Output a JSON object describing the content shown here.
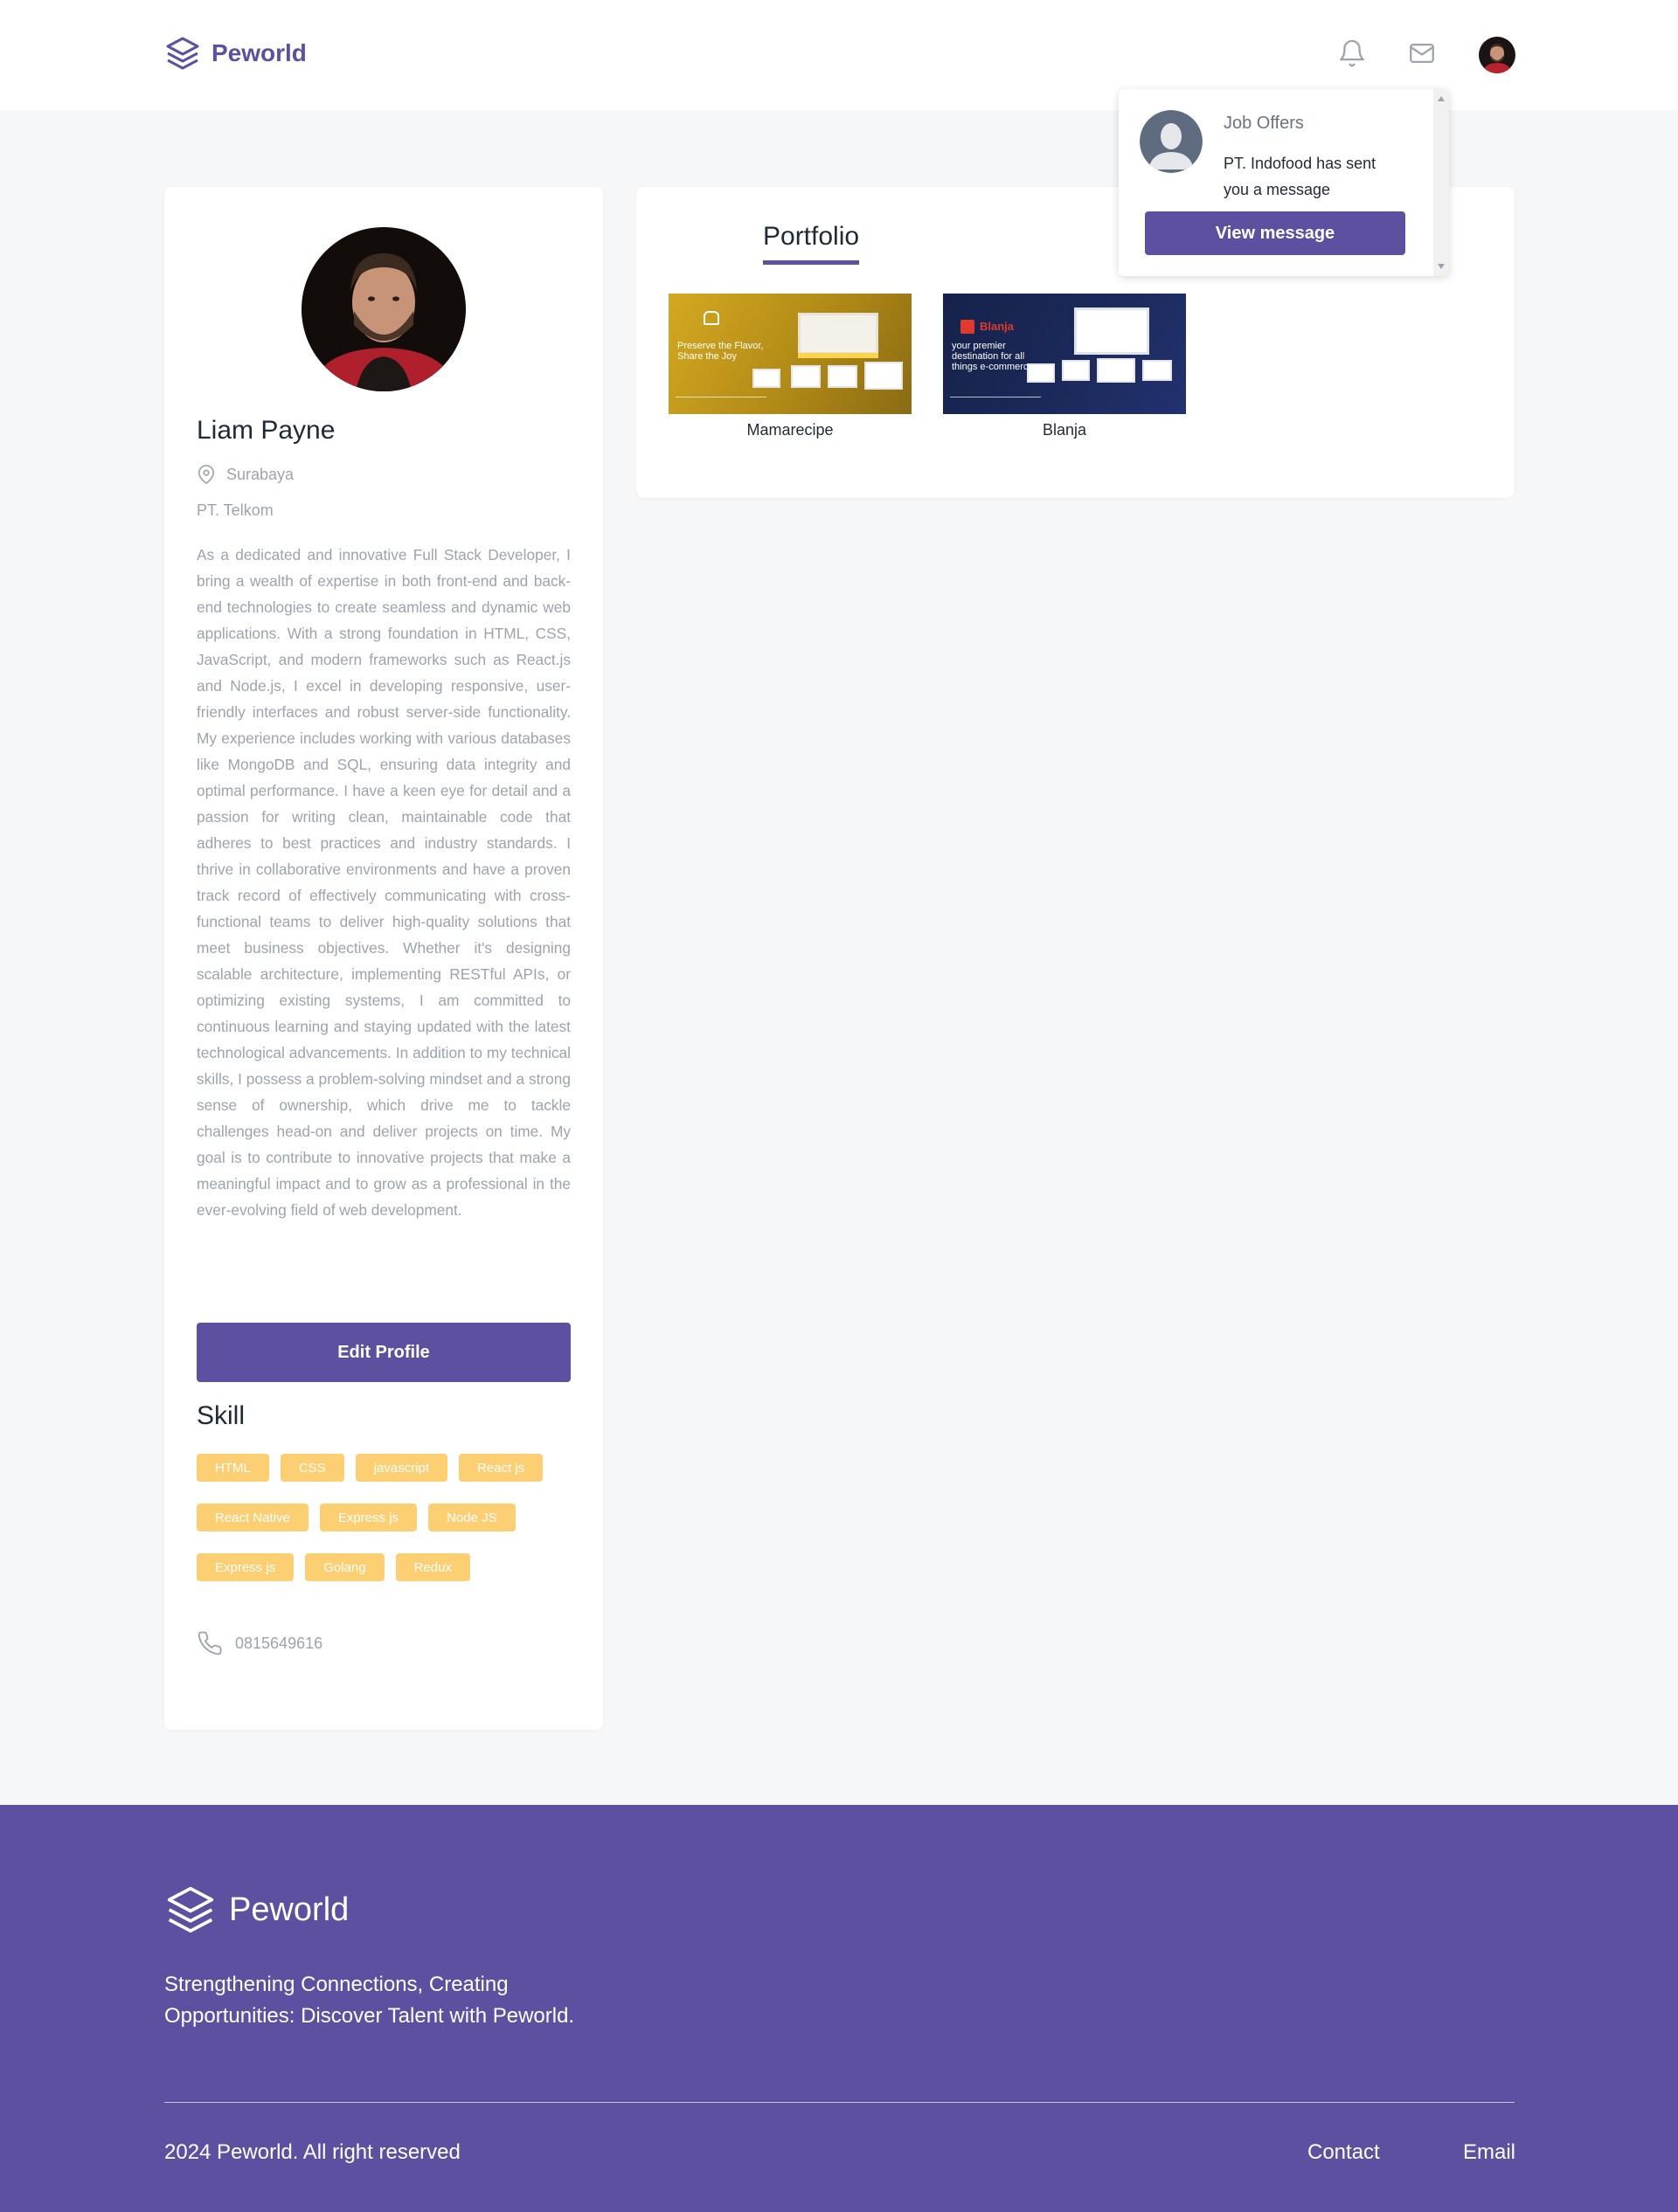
{
  "navbar": {
    "brand": "Peworld",
    "icons": [
      "bell-icon",
      "mail-icon"
    ]
  },
  "notification": {
    "title": "Job Offers",
    "message": "PT. Indofood has sent you a message",
    "button_label": "View message"
  },
  "profile": {
    "name": "Liam Payne",
    "location": "Surabaya",
    "company": "PT. Telkom",
    "bio": "As a dedicated and innovative Full Stack Developer, I bring a wealth of expertise in both front-end and back-end technologies to create seamless and dynamic web applications. With a strong foundation in HTML, CSS, JavaScript, and modern frameworks such as React.js and Node.js, I excel in developing responsive, user-friendly interfaces and robust server-side functionality. My experience includes working with various databases like MongoDB and SQL, ensuring data integrity and optimal performance. I have a keen eye for detail and a passion for writing clean, maintainable code that adheres to best practices and industry standards. I thrive in collaborative environments and have a proven track record of effectively communicating with cross-functional teams to deliver high-quality solutions that meet business objectives. Whether it's designing scalable architecture, implementing RESTful APIs, or optimizing existing systems, I am committed to continuous learning and staying updated with the latest technological advancements. In addition to my technical skills, I possess a problem-solving mindset and a strong sense of ownership, which drive me to tackle challenges head-on and deliver projects on time. My goal is to contribute to innovative projects that make a meaningful impact and to grow as a professional in the ever-evolving field of web development.",
    "edit_button": "Edit Profile",
    "skill_title": "Skill",
    "skills": [
      [
        "HTML",
        "CSS",
        "javascript",
        "React js"
      ],
      [
        "React Native",
        "Express js",
        "Node JS"
      ],
      [
        "Express js",
        "Golang",
        "Redux"
      ]
    ],
    "phone": "0815649616"
  },
  "portfolio": {
    "tab_label": "Portfolio",
    "items": [
      {
        "label": "Mamarecipe",
        "thumb_text": "Preserve the Flavor, Share the Joy"
      },
      {
        "label": "Blanja",
        "thumb_brand": "Blanja",
        "thumb_text": "your premier destination for all things e-commerce"
      }
    ]
  },
  "footer": {
    "brand": "Peworld",
    "tagline": "Strengthening Connections, Creating Opportunities: Discover Talent with Peworld.",
    "copyright": "2024 Peworld. All right reserved",
    "links": [
      "Contact",
      "Email"
    ]
  },
  "colors": {
    "primary": "#5e50a1",
    "skill_tag": "#fbb017",
    "background": "#f6f7f8",
    "muted_text": "#9ca3af"
  }
}
